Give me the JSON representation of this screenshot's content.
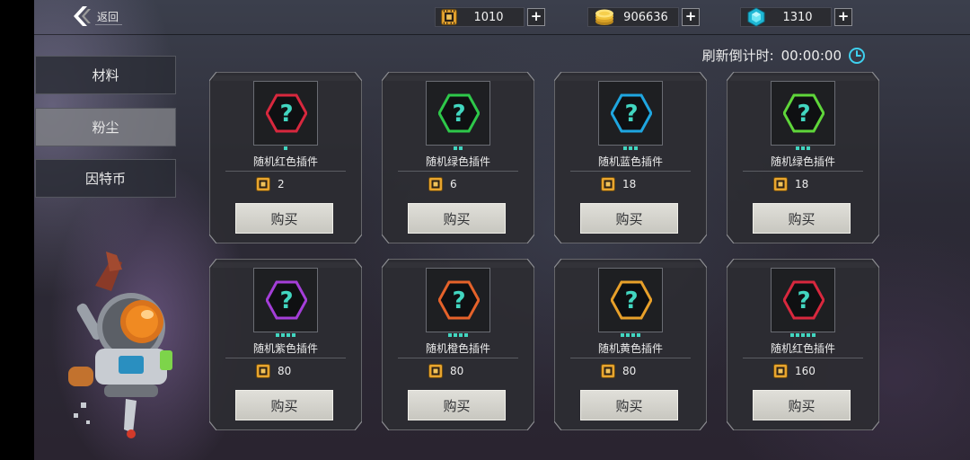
{
  "header": {
    "back_label": "返回",
    "currencies": [
      {
        "name": "chip",
        "value": "1010",
        "icon": "chip-icon"
      },
      {
        "name": "gold",
        "value": "906636",
        "icon": "gold-coins-icon"
      },
      {
        "name": "gem",
        "value": "1310",
        "icon": "cyan-gem-icon"
      }
    ],
    "plus_label": "+"
  },
  "sidebar": {
    "items": [
      {
        "label": "材料",
        "active": false
      },
      {
        "label": "粉尘",
        "active": true
      },
      {
        "label": "因特币",
        "active": false
      }
    ]
  },
  "shop": {
    "countdown_label": "刷新倒计时:",
    "countdown_value": "00:00:00",
    "buy_label": "购买",
    "items": [
      {
        "name": "随机红色插件",
        "price": "2",
        "color": "#d8283e",
        "dots": 1
      },
      {
        "name": "随机绿色插件",
        "price": "6",
        "color": "#2ec84a",
        "dots": 2
      },
      {
        "name": "随机蓝色插件",
        "price": "18",
        "color": "#1fa6e0",
        "dots": 3
      },
      {
        "name": "随机绿色插件",
        "price": "18",
        "color": "#5fd63a",
        "dots": 3
      },
      {
        "name": "随机紫色插件",
        "price": "80",
        "color": "#a43ed8",
        "dots": 4
      },
      {
        "name": "随机橙色插件",
        "price": "80",
        "color": "#e5622a",
        "dots": 4
      },
      {
        "name": "随机黄色插件",
        "price": "80",
        "color": "#e8a02a",
        "dots": 4
      },
      {
        "name": "随机红色插件",
        "price": "160",
        "color": "#d8283e",
        "dots": 5
      }
    ]
  },
  "colors": {
    "accent_cyan": "#42d6c0",
    "chip_gold": "#e8a52e",
    "clock_cyan": "#3fd0ee"
  }
}
